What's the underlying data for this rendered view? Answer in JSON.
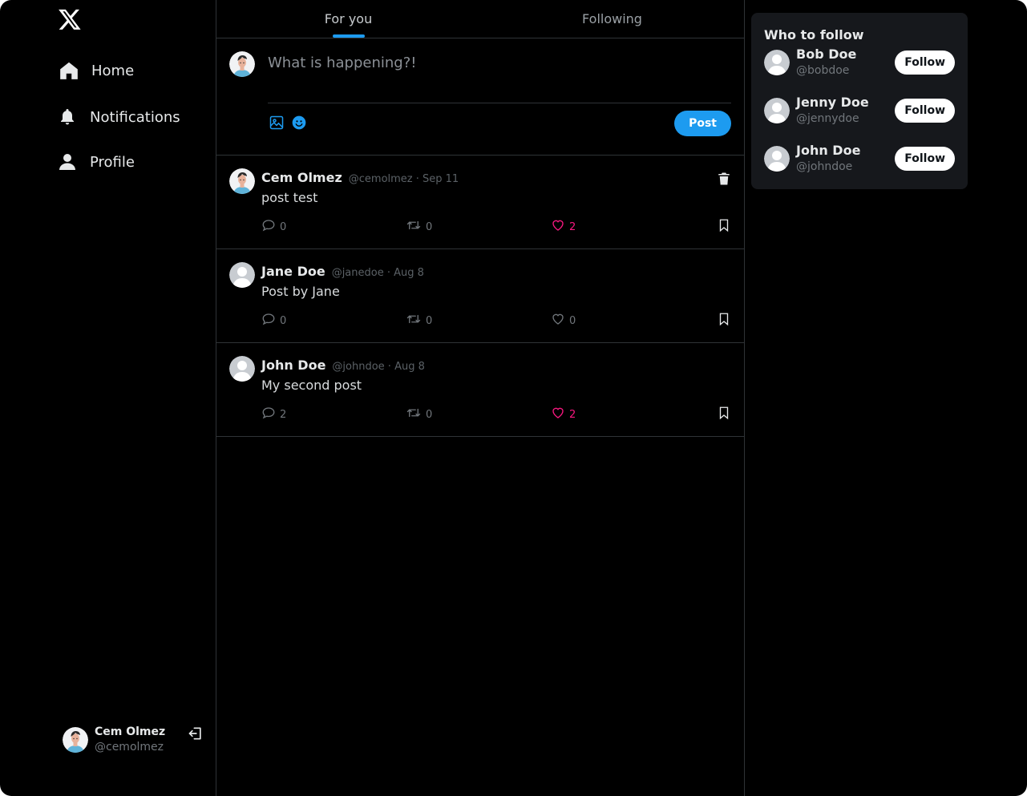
{
  "colors": {
    "accent": "#1d9bf0",
    "like": "#f91880",
    "background": "#000000",
    "card": "#16181c",
    "border": "#2f3336"
  },
  "sidebar": {
    "logo_icon": "x-logo-icon",
    "nav": [
      {
        "label": "Home",
        "icon": "home-icon"
      },
      {
        "label": "Notifications",
        "icon": "bell-icon"
      },
      {
        "label": "Profile",
        "icon": "user-icon"
      }
    ],
    "account": {
      "name": "Cem Olmez",
      "handle": "@cemolmez",
      "logout_icon": "logout-icon"
    }
  },
  "tabs": [
    {
      "label": "For you",
      "active": true
    },
    {
      "label": "Following",
      "active": false
    }
  ],
  "composer": {
    "placeholder": "What is happening?!",
    "post_label": "Post",
    "tools": [
      "image-icon",
      "emoji-icon"
    ]
  },
  "posts": [
    {
      "name": "Cem Olmez",
      "meta": "@cemolmez · Sep 11",
      "text": "post test",
      "replies": "0",
      "reposts": "0",
      "likes": "2",
      "liked": true,
      "deletable": true,
      "avatar": "illustrated"
    },
    {
      "name": "Jane Doe",
      "meta": "@janedoe · Aug 8",
      "text": "Post by Jane",
      "replies": "0",
      "reposts": "0",
      "likes": "0",
      "liked": false,
      "deletable": false,
      "avatar": "default"
    },
    {
      "name": "John Doe",
      "meta": "@johndoe · Aug 8",
      "text": "My second post",
      "replies": "2",
      "reposts": "0",
      "likes": "2",
      "liked": true,
      "deletable": false,
      "avatar": "default"
    }
  ],
  "who_to_follow": {
    "title": "Who to follow",
    "follow_label": "Follow",
    "users": [
      {
        "name": "Bob Doe",
        "handle": "@bobdoe"
      },
      {
        "name": "Jenny Doe",
        "handle": "@jennydoe"
      },
      {
        "name": "John Doe",
        "handle": "@johndoe"
      }
    ]
  }
}
